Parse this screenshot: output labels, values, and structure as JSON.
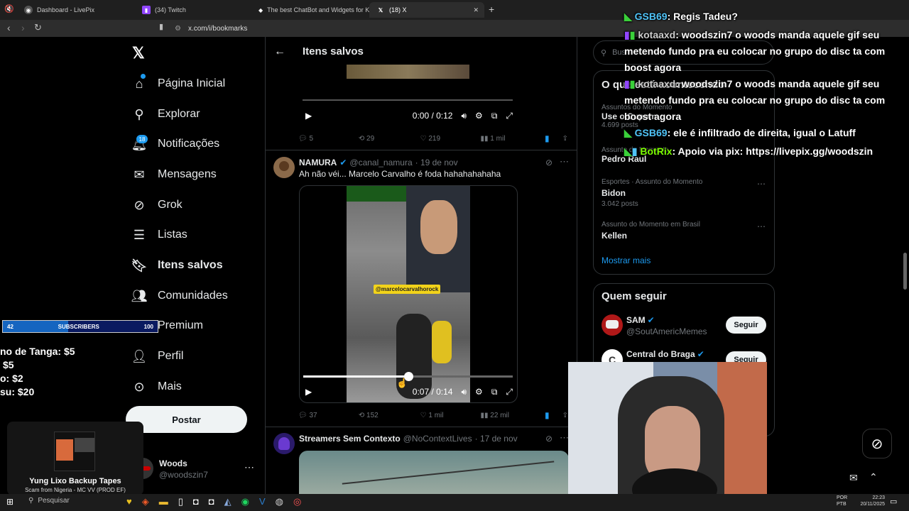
{
  "tabs": [
    {
      "title": "Dashboard - LivePix",
      "icon": "livepix-icon"
    },
    {
      "title": "(34) Twitch",
      "icon": "twitch-icon"
    },
    {
      "title": "The best ChatBot and Widgets for Ki",
      "icon": "botrix-icon"
    },
    {
      "title": "(18) X",
      "icon": "x-icon"
    }
  ],
  "url": "x.com/i/bookmarks",
  "sidebar": {
    "items": [
      {
        "label": "Página Inicial",
        "icon": "home-icon"
      },
      {
        "label": "Explorar",
        "icon": "search-icon"
      },
      {
        "label": "Notificações",
        "icon": "bell-icon",
        "badge": "18"
      },
      {
        "label": "Mensagens",
        "icon": "mail-icon"
      },
      {
        "label": "Grok",
        "icon": "grok-icon"
      },
      {
        "label": "Listas",
        "icon": "list-icon"
      },
      {
        "label": "Itens salvos",
        "icon": "bookmark-icon"
      },
      {
        "label": "Comunidades",
        "icon": "communities-icon"
      },
      {
        "label": "Premium",
        "icon": "x-premium-icon"
      },
      {
        "label": "Perfil",
        "icon": "person-icon"
      },
      {
        "label": "Mais",
        "icon": "more-icon"
      }
    ],
    "post_label": "Postar",
    "account_name": "Woods",
    "account_handle": "@woodszin7"
  },
  "feed": {
    "header": "Itens salvos",
    "tweet1": {
      "time": "0:00 / 0:12",
      "replies": "5",
      "retweets": "29",
      "likes": "219",
      "views": "1 mil"
    },
    "tweet2": {
      "name": "NAMURA",
      "handle": "@canal_namura",
      "date": "· 19 de nov",
      "text": "Ah não véi... Marcelo Carvalho é foda hahahahahaha",
      "video_tag": "@marcelocarvalhorock",
      "time": "0:07 / 0:14",
      "progress": 0.5,
      "replies": "37",
      "retweets": "152",
      "likes": "1 mil",
      "views": "22 mil"
    },
    "tweet3": {
      "name": "Streamers Sem Contexto",
      "handle": "@NoContextLives",
      "date": "· 17 de nov"
    }
  },
  "right": {
    "search_placeholder": "Bus",
    "trends_title": "O que está acontecendo",
    "trends": [
      {
        "cat": "Assuntos do Momento",
        "name": "Use o Cupom",
        "posts": "4.699 posts"
      },
      {
        "cat": "Assunto do Momento",
        "name": "Pedro Raul",
        "posts": ""
      },
      {
        "cat": "Esportes · Assunto do Momento",
        "name": "Bidon",
        "posts": "3.042 posts"
      },
      {
        "cat": "Assunto do Momento em Brasil",
        "name": "Kellen",
        "posts": ""
      }
    ],
    "show_more": "Mostrar mais",
    "follow_title": "Quem seguir",
    "follow": [
      {
        "name": "SAM",
        "handle": "@SoutAmericMemes",
        "button": "Seguir"
      },
      {
        "name": "Central do Braga",
        "handle": "",
        "button": "Seguir"
      }
    ]
  },
  "overlay": {
    "subs_current": "42",
    "subs_label": "SUBSCRIBERS",
    "subs_goal": "100",
    "donations": [
      "no de Tanga: $5",
      "$5",
      "o: $2",
      "su: $20"
    ],
    "song_title": "Yung Lixo Backup Tapes",
    "song_sub": "Scam from Nigeria - MC VV (PROD EF)",
    "chat": [
      {
        "user": "GSB69",
        "msg": ": Regis Tadeu?",
        "color": "#4fc3f7"
      },
      {
        "user": "kotaaxd",
        "msg": ": woodszin7 o woods manda aquele gif seu metendo fundo pra eu colocar no grupo do disc ta com boost agora",
        "color": "#ffffff"
      },
      {
        "user": "kotaaxd",
        "msg": ": woodszin7 o woods manda aquele gif seu metendo fundo pra eu colocar no grupo do disc ta com boost agora",
        "color": "#ffffff"
      },
      {
        "user": "GSB69",
        "msg": ": ele é infiltrado de direita, igual o Latuff",
        "color": "#4fc3f7"
      },
      {
        "user": "BotRix",
        "msg": ": Apoio via pix: https://livepix.gg/woodszin",
        "color": "#7cfc00"
      }
    ]
  },
  "taskbar": {
    "search": "Pesquisar",
    "lang": "POR",
    "lang2": "PTB",
    "time": "22:23",
    "date": "20/11/2025"
  }
}
